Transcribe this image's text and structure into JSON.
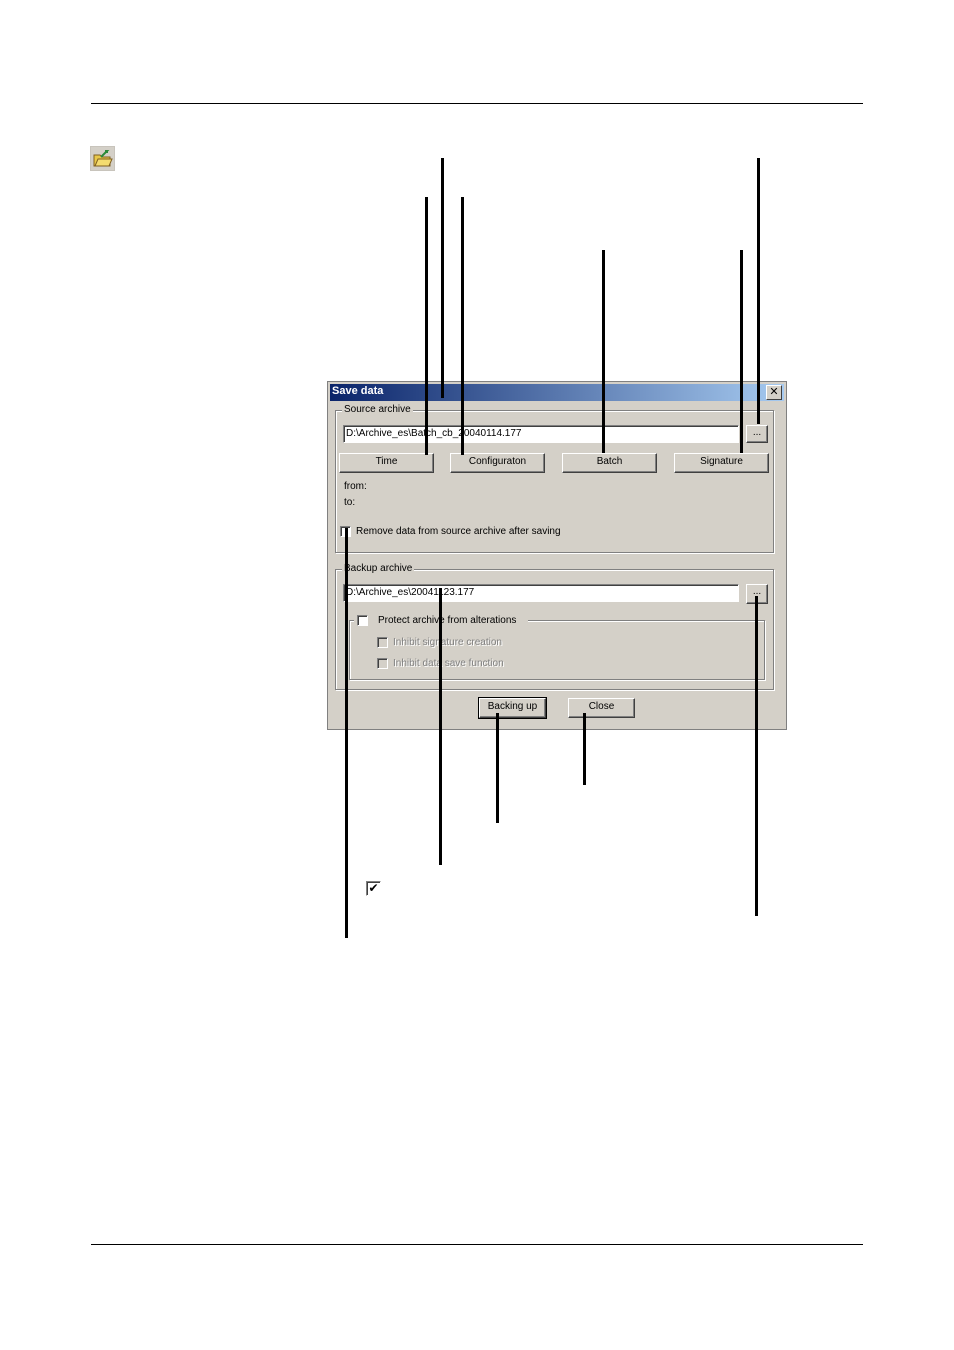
{
  "dialog": {
    "title": "Save data",
    "close_glyph": "✕",
    "source": {
      "group_label": "Source archive",
      "path_value": "D:\\Archive_es\\Batch_cb_20040114.177",
      "browse_label": "...",
      "buttons": {
        "time": "Time",
        "configuration": "Configuraton",
        "batch": "Batch",
        "signature": "Signature"
      },
      "from_label": "from:",
      "to_label": "to:",
      "remove_label": "Remove data from source archive after saving"
    },
    "backup": {
      "group_label": "Backup archive",
      "path_value": "D:\\Archive_es\\20041123.177",
      "browse_label": "...",
      "protect_label": "Protect archive from alterations",
      "inhibit_signature_label": "Inhibit signature creation",
      "inhibit_save_label": "Inhibit data save function"
    },
    "actions": {
      "backup": "Backing up",
      "close": "Close"
    }
  },
  "icons": {
    "toolbar": "save-data-folder-icon",
    "sample_check": "checkmark-icon"
  },
  "sample_check_glyph": "✔"
}
